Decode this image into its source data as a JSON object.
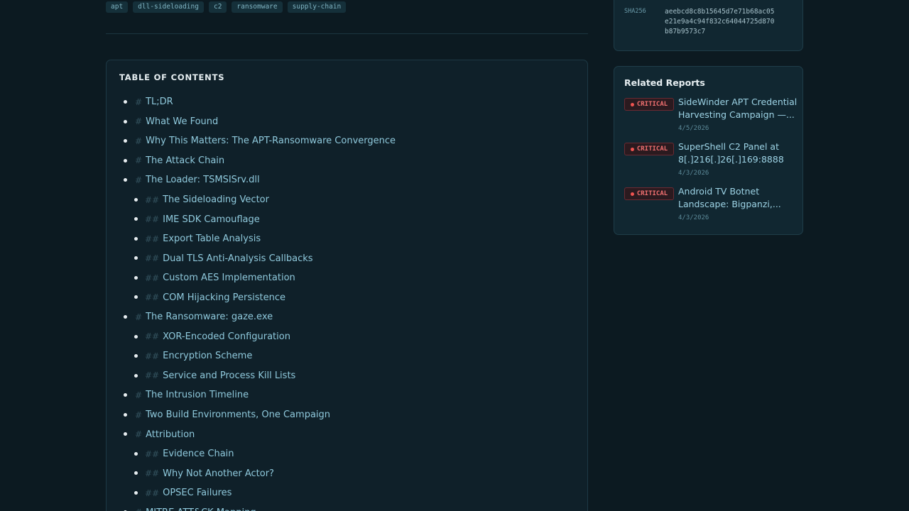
{
  "tags": [
    "apt",
    "dll-sideloading",
    "c2",
    "ransomware",
    "supply-chain"
  ],
  "hashes": {
    "key": "SHA256",
    "lines": [
      "aeebcd8c8b15645d7e71b68ac05",
      "e21e9a4c94f832c64044725d870",
      "b87b9573c7"
    ]
  },
  "toc": {
    "title": "TABLE OF CONTENTS",
    "items": [
      {
        "level": 1,
        "label": "TL;DR"
      },
      {
        "level": 1,
        "label": "What We Found"
      },
      {
        "level": 1,
        "label": "Why This Matters: The APT-Ransomware Convergence"
      },
      {
        "level": 1,
        "label": "The Attack Chain"
      },
      {
        "level": 1,
        "label": "The Loader: TSMSISrv.dll"
      },
      {
        "level": 2,
        "label": "The Sideloading Vector"
      },
      {
        "level": 2,
        "label": "IME SDK Camouflage"
      },
      {
        "level": 2,
        "label": "Export Table Analysis"
      },
      {
        "level": 2,
        "label": "Dual TLS Anti-Analysis Callbacks"
      },
      {
        "level": 2,
        "label": "Custom AES Implementation"
      },
      {
        "level": 2,
        "label": "COM Hijacking Persistence"
      },
      {
        "level": 1,
        "label": "The Ransomware: gaze.exe"
      },
      {
        "level": 2,
        "label": "XOR-Encoded Configuration"
      },
      {
        "level": 2,
        "label": "Encryption Scheme"
      },
      {
        "level": 2,
        "label": "Service and Process Kill Lists"
      },
      {
        "level": 1,
        "label": "The Intrusion Timeline"
      },
      {
        "level": 1,
        "label": "Two Build Environments, One Campaign"
      },
      {
        "level": 1,
        "label": "Attribution"
      },
      {
        "level": 2,
        "label": "Evidence Chain"
      },
      {
        "level": 2,
        "label": "Why Not Another Actor?"
      },
      {
        "level": 2,
        "label": "OPSEC Failures"
      },
      {
        "level": 1,
        "label": "MITRE ATT&CK Mapping"
      }
    ]
  },
  "related": {
    "title": "Related Reports",
    "reports": [
      {
        "severity": "CRITICAL",
        "title": "SideWinder APT Credential Harvesting Campaign —...",
        "date": "4/5/2026"
      },
      {
        "severity": "CRITICAL",
        "title": "SuperShell C2 Panel at 8[.]216[.]26[.]169:8888",
        "date": "4/3/2026"
      },
      {
        "severity": "CRITICAL",
        "title": "Android TV Botnet Landscape: Bigpanzi,...",
        "date": "4/3/2026"
      }
    ]
  },
  "colors": {
    "critical": "#ef5350",
    "link": "#8fc9dc",
    "background": "#0c1a21"
  }
}
